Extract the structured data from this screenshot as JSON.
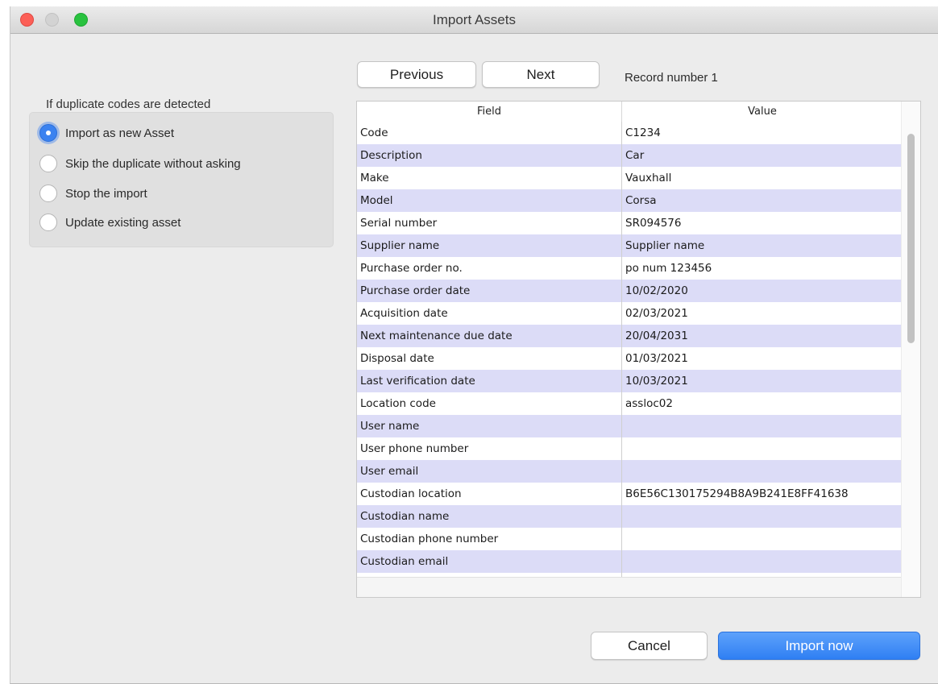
{
  "window": {
    "title": "Import Assets"
  },
  "nav": {
    "previous_label": "Previous",
    "next_label": "Next",
    "record_label": "Record number 1"
  },
  "duplicates": {
    "title": "If duplicate codes are detected",
    "options": [
      {
        "label": "Import as new Asset",
        "selected": true
      },
      {
        "label": "Skip the duplicate without asking",
        "selected": false
      },
      {
        "label": "Stop the import",
        "selected": false
      },
      {
        "label": "Update existing asset",
        "selected": false
      }
    ]
  },
  "table": {
    "columns": [
      "Field",
      "Value"
    ],
    "rows": [
      {
        "field": "Code",
        "value": "C1234"
      },
      {
        "field": "Description",
        "value": "Car"
      },
      {
        "field": "Make",
        "value": "Vauxhall"
      },
      {
        "field": "Model",
        "value": "Corsa"
      },
      {
        "field": "Serial number",
        "value": "SR094576"
      },
      {
        "field": "Supplier name",
        "value": "Supplier name"
      },
      {
        "field": "Purchase order no.",
        "value": "po num 123456"
      },
      {
        "field": "Purchase order date",
        "value": "10/02/2020"
      },
      {
        "field": "Acquisition date",
        "value": "02/03/2021"
      },
      {
        "field": "Next maintenance due date",
        "value": "20/04/2031"
      },
      {
        "field": "Disposal date",
        "value": "01/03/2021"
      },
      {
        "field": "Last verification date",
        "value": "10/03/2021"
      },
      {
        "field": "Location code",
        "value": "assloc02"
      },
      {
        "field": "User name",
        "value": ""
      },
      {
        "field": "User phone number",
        "value": ""
      },
      {
        "field": "User email",
        "value": ""
      },
      {
        "field": "Custodian location",
        "value": "B6E56C130175294B8A9B241E8FF41638"
      },
      {
        "field": "Custodian name",
        "value": ""
      },
      {
        "field": "Custodian phone number",
        "value": ""
      },
      {
        "field": "Custodian email",
        "value": ""
      }
    ]
  },
  "actions": {
    "cancel_label": "Cancel",
    "import_label": "Import now"
  },
  "colors": {
    "accent": "#3b82f0",
    "row_stripe": "#dcdcf7",
    "close": "#fc5f57",
    "maximize": "#29c23f"
  }
}
